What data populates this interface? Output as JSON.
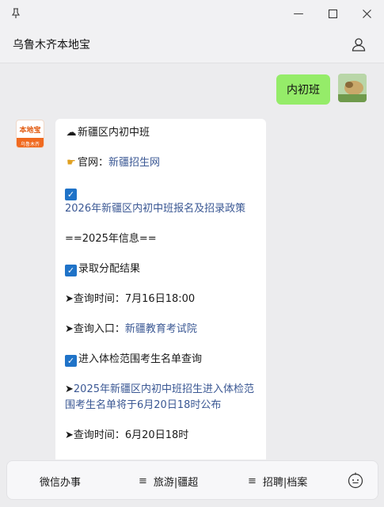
{
  "window": {
    "pin_icon": "pin-icon",
    "minimize_glyph": "—",
    "maximize_glyph": "☐",
    "close_glyph": "✕"
  },
  "header": {
    "title": "乌鲁木齐本地宝",
    "profile_icon": "person-icon"
  },
  "user_message": {
    "text": "内初班"
  },
  "bot": {
    "avatar_top": "本地宝",
    "avatar_bottom": "乌鲁木齐",
    "heading": "新疆区内初中班",
    "official_label": "官网：",
    "official_link": "新疆招生网",
    "policy_link": "2026年新疆区内初中班报名及招录政策",
    "info_2025": "==2025年信息==",
    "result_label": "录取分配结果",
    "query_time_label": "➤查询时间：7月16日18:00",
    "query_entry_label": "➤查询入口：",
    "query_entry_link": "新疆教育考试院",
    "physical_label": "进入体检范围考生名单查询",
    "announce_prefix": "➤",
    "announce_link": "2025年新疆区内初中班招生进入体检范围考生名单将于6月20日18时公布",
    "query_time_2": "➤查询时间：6月20日18时"
  },
  "bottom_menu": {
    "item1": "微信办事",
    "item2": "旅游|疆超",
    "item3": "招聘|档案",
    "menu_glyph": "≡"
  },
  "colors": {
    "user_bubble": "#95ec69",
    "link": "#3b5894",
    "checkbox": "#1f73c8",
    "brand_orange": "#f06a20"
  }
}
